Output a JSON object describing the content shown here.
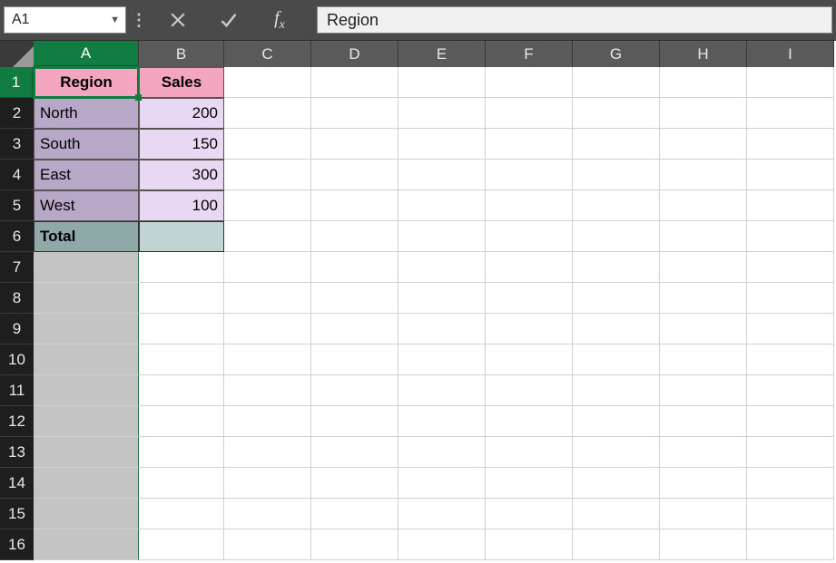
{
  "formula_bar": {
    "cell_ref": "A1",
    "formula_value": "Region"
  },
  "columns": [
    "A",
    "B",
    "C",
    "D",
    "E",
    "F",
    "G",
    "H",
    "I"
  ],
  "active_column": "A",
  "rows": [
    1,
    2,
    3,
    4,
    5,
    6,
    7,
    8,
    9,
    10,
    11,
    12,
    13,
    14,
    15,
    16
  ],
  "active_row": 1,
  "active_cell": "A1",
  "sheet": {
    "A1": "Region",
    "B1": "Sales",
    "A2": "North",
    "B2": "200",
    "A3": "South",
    "B3": "150",
    "A4": "East",
    "B4": "300",
    "A5": "West",
    "B5": "100",
    "A6": "Total",
    "B6": ""
  },
  "chart_data": {
    "type": "table",
    "title": "",
    "columns": [
      "Region",
      "Sales"
    ],
    "rows": [
      {
        "Region": "North",
        "Sales": 200
      },
      {
        "Region": "South",
        "Sales": 150
      },
      {
        "Region": "East",
        "Sales": 300
      },
      {
        "Region": "West",
        "Sales": 100
      }
    ],
    "total_row": {
      "Region": "Total",
      "Sales": null
    }
  }
}
